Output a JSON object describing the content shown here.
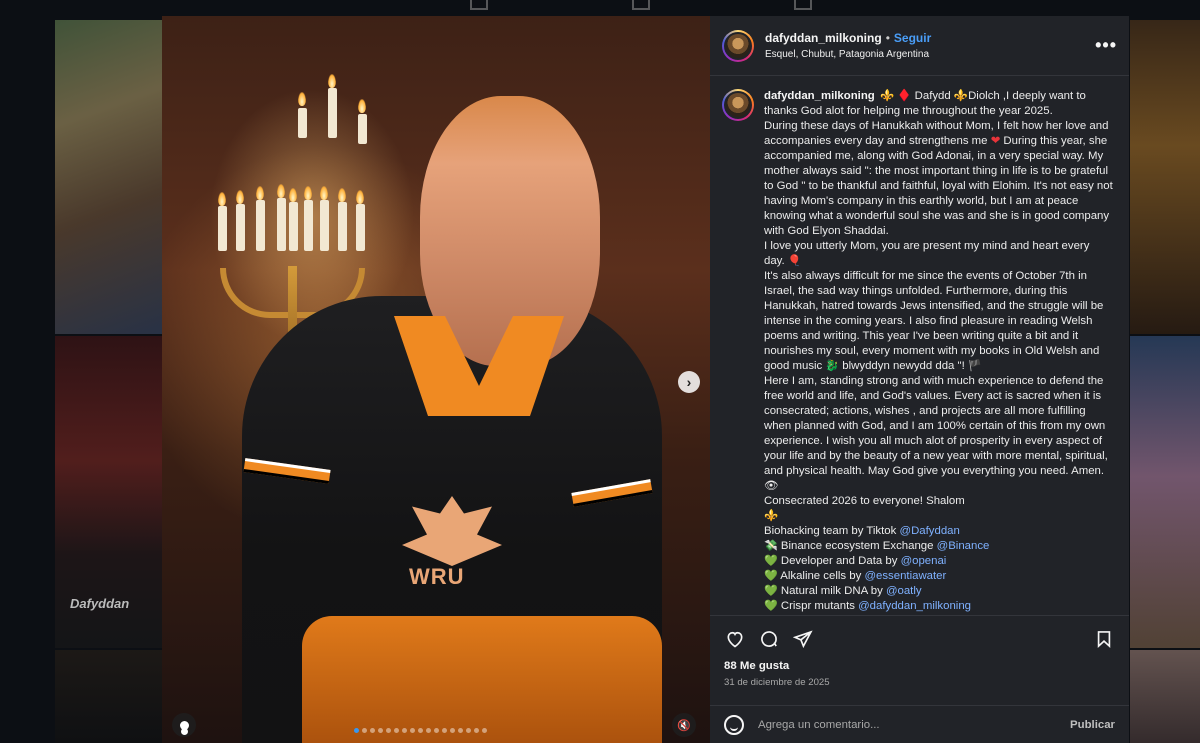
{
  "background": {
    "watermark_label": "Dafyddan"
  },
  "media": {
    "crest_text": "WRU",
    "carousel_dot_count": 17,
    "active_dot_index": 0
  },
  "post": {
    "username": "dafyddan_milkoning",
    "separator": "•",
    "follow_label": "Seguir",
    "location": "Esquel, Chubut, Patagonia Argentina",
    "more_label": "•••",
    "caption": {
      "intro": "⚜️ ♦️ Dafydd ⚜️Diolch ,I deeply want to thanks God alot for helping me throughout the year 2025.",
      "p1a": "During these days of Hanukkah without Mom, I felt how her love and accompanies every day and strengthens me",
      "p1b": "During this year, she accompanied me, along with God Adonai, in a very special way. My mother always said \": the most important thing in life is to be grateful to God \" to be thankful and faithful, loyal with Elohim. It's not easy not having Mom's company in this earthly world, but I am at peace knowing what a wonderful soul she was and she is in good company with God Elyon Shaddai.",
      "p2": "I love you utterly Mom, you are present my mind and heart every day.",
      "p3": "It's also always difficult for me since the events of October 7th in Israel, the sad way things unfolded. Furthermore, during this Hanukkah, hatred towards Jews intensified, and the struggle will be intense in the coming years. I also find pleasure in reading Welsh poems and writing. This year I've been writing quite a bit and it nourishes my soul, every moment with my books in Old Welsh and good music",
      "p3b": "blwyddyn newydd dda \"!",
      "p4": "Here I am, standing strong and with much experience to defend the free world and life, and God's values. Every act is sacred when it is consecrated; actions, wishes , and projects are all more fulfilling when planned with God, and I am 100% certain of this from my own experience. I wish you all much alot of prosperity in every aspect of your life and by the beauty of a new year with more mental, spiritual, and physical health. May God give you everything you need. Amen.👁",
      "p5": "Consecrated 2026 to everyone! Shalom",
      "p6": "⚜️",
      "credits": [
        {
          "icon": "",
          "text": "Biohacking team by Tiktok ",
          "mention": "@Dafyddan"
        },
        {
          "icon": "💸",
          "text": "Binance ecosystem Exchange ",
          "mention": "@Binance"
        },
        {
          "icon": "💚",
          "text": "Developer and Data by ",
          "mention": "@openai"
        },
        {
          "icon": "💚",
          "text": "Alkaline cells by ",
          "mention": "@essentiawater"
        },
        {
          "icon": "💚",
          "text": "Natural milk DNA by ",
          "mention": "@oatly"
        },
        {
          "icon": "💚",
          "text": "Crispr mutants ",
          "mention": "@dafyddan_milkoning"
        }
      ]
    },
    "likes": "88 Me gusta",
    "date": "31 de diciembre de 2025",
    "comment_placeholder": "Agrega un comentario...",
    "publish_label": "Publicar"
  },
  "colors": {
    "panel_bg": "#212328",
    "link": "#4a9ef8",
    "mention": "#7fb1ff"
  },
  "icons": [
    "heart-icon",
    "comment-icon",
    "share-icon",
    "bookmark-icon",
    "emoji-icon",
    "chevron-right-icon",
    "user-tag-icon",
    "mute-icon",
    "more-icon"
  ]
}
